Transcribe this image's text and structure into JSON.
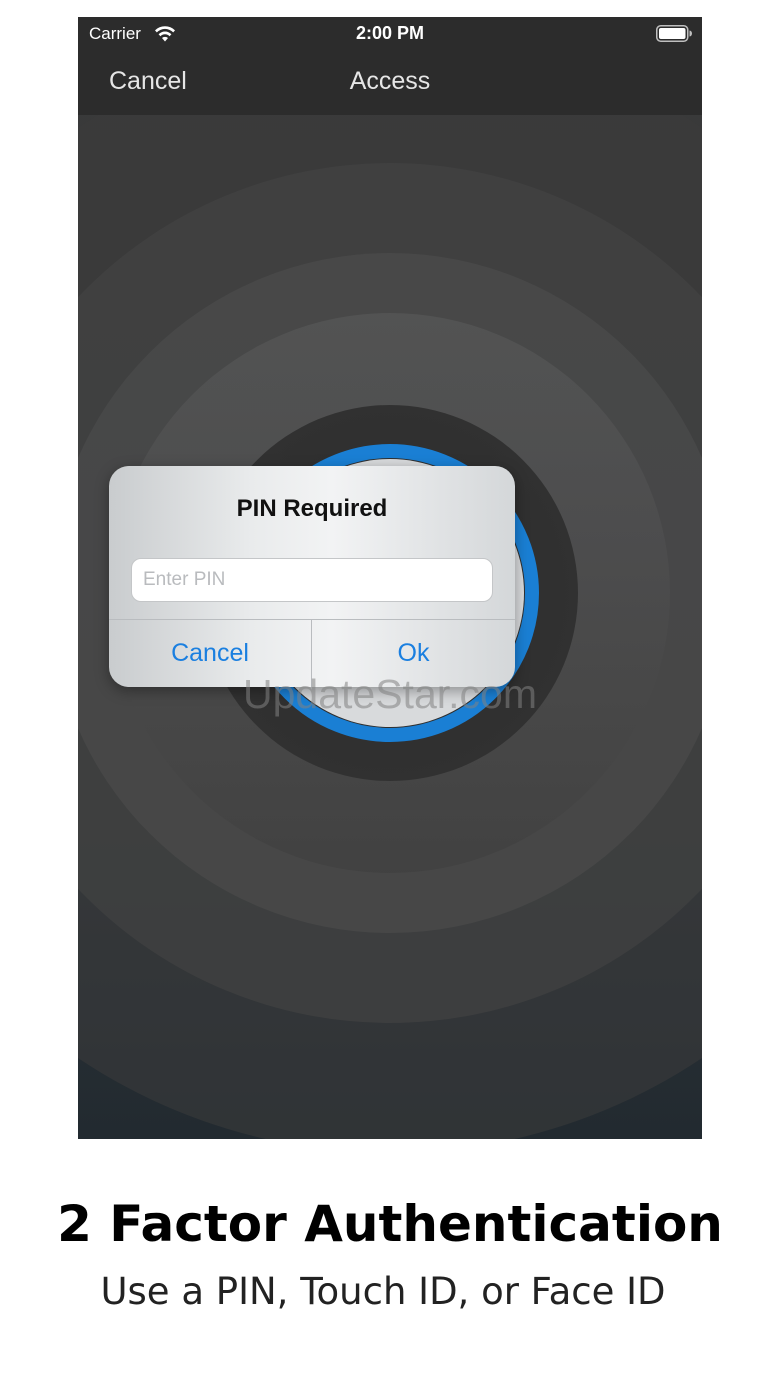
{
  "status_bar": {
    "carrier": "Carrier",
    "time": "2:00 PM",
    "wifi_icon": "wifi-icon",
    "battery_icon": "battery-full-icon"
  },
  "nav_bar": {
    "cancel_label": "Cancel",
    "title": "Access"
  },
  "alert": {
    "title": "PIN Required",
    "input_placeholder": "Enter PIN",
    "input_value": "",
    "cancel_label": "Cancel",
    "ok_label": "Ok"
  },
  "watermark": "UpdateStar.com",
  "caption": {
    "title": "2 Factor Authentication",
    "subtitle": "Use a PIN, Touch ID, or Face ID"
  },
  "colors": {
    "accent_blue": "#1a7fe0",
    "fingerprint_ring": "#1a7fd4",
    "nav_background": "#2c2c2c"
  }
}
